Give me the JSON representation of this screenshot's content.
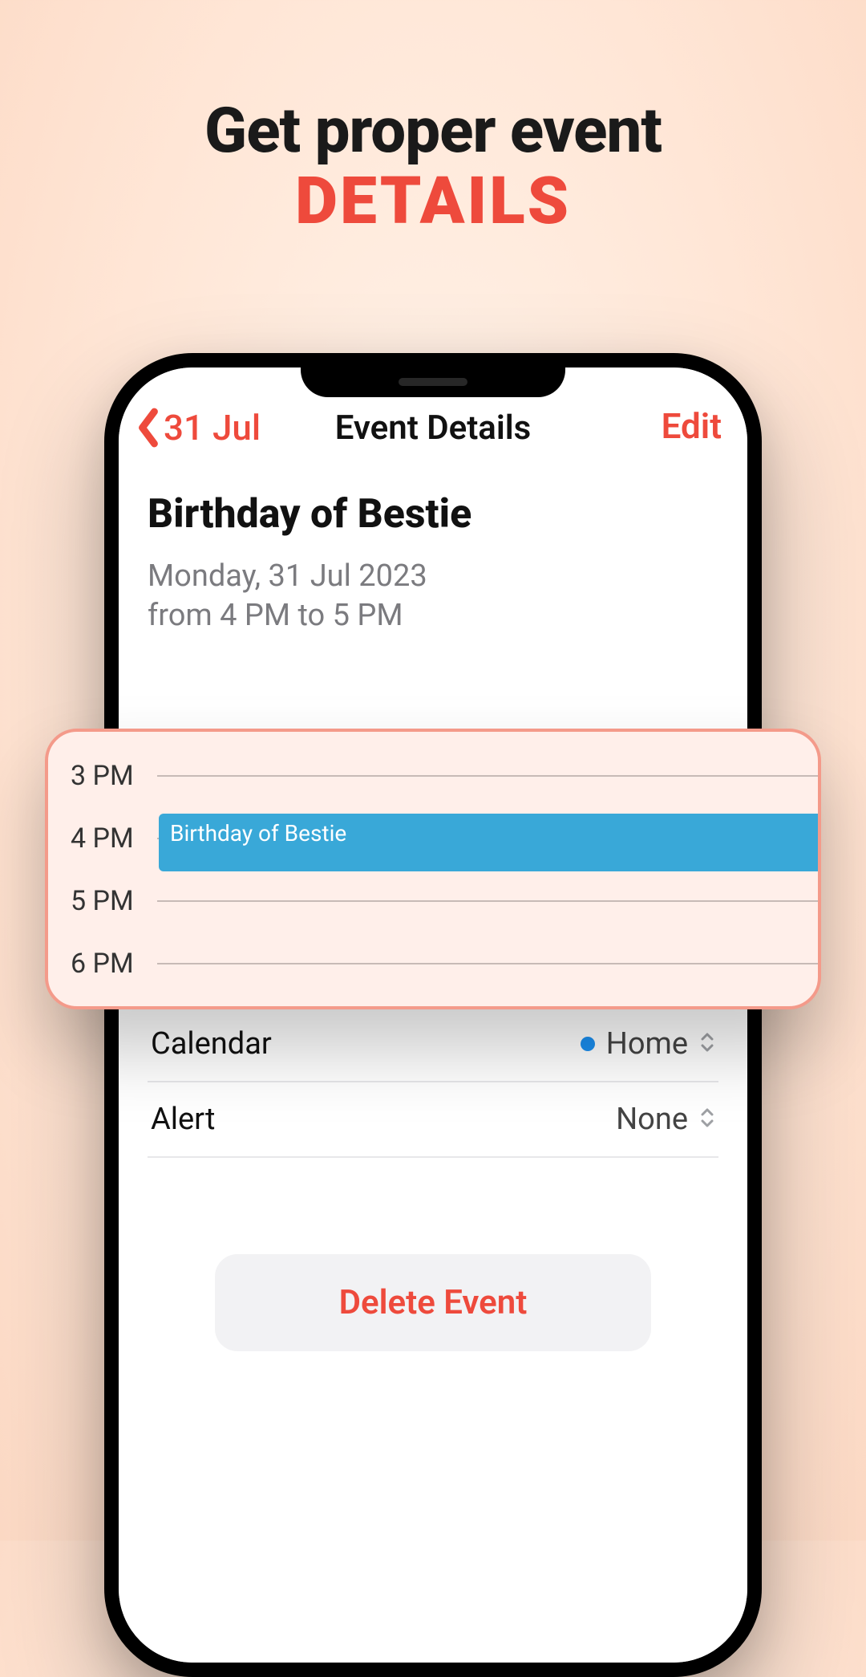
{
  "headline": {
    "line1": "Get proper event",
    "line2": "DETAILS"
  },
  "nav": {
    "back_label": "31 Jul",
    "title": "Event Details",
    "edit_label": "Edit"
  },
  "event": {
    "title": "Birthday of Bestie",
    "date_line": "Monday, 31 Jul 2023",
    "time_line": "from 4 PM to 5 PM"
  },
  "timeline": {
    "hours": [
      "3 PM",
      "4 PM",
      "5 PM",
      "6 PM"
    ],
    "block_title": "Birthday of Bestie"
  },
  "rows": {
    "calendar": {
      "label": "Calendar",
      "value": "Home",
      "dot_color": "#1b8ff0"
    },
    "alert": {
      "label": "Alert",
      "value": "None"
    }
  },
  "delete_label": "Delete Event"
}
